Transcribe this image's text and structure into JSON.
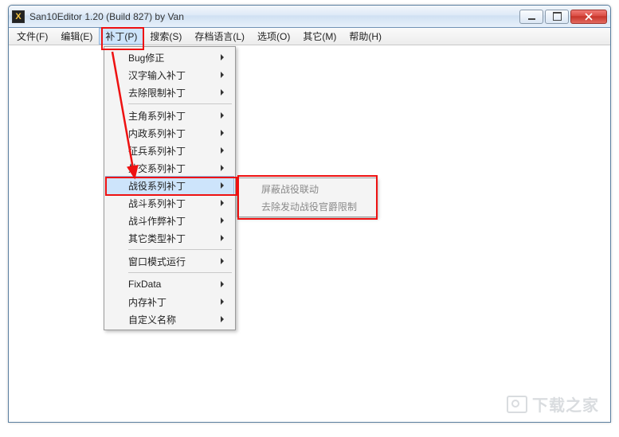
{
  "window": {
    "title": "San10Editor 1.20 (Build 827) by Van",
    "icon_letter": "X"
  },
  "menubar": {
    "items": [
      {
        "label": "文件(F)"
      },
      {
        "label": "编辑(E)"
      },
      {
        "label": "补丁(P)",
        "active": true
      },
      {
        "label": "搜索(S)"
      },
      {
        "label": "存档语言(L)"
      },
      {
        "label": "选项(O)"
      },
      {
        "label": "其它(M)"
      },
      {
        "label": "帮助(H)"
      }
    ]
  },
  "dropdown": {
    "groups": [
      [
        {
          "label": "Bug修正",
          "sub": true
        },
        {
          "label": "汉字输入补丁",
          "sub": true
        },
        {
          "label": "去除限制补丁",
          "sub": true
        }
      ],
      [
        {
          "label": "主角系列补丁",
          "sub": true
        },
        {
          "label": "内政系列补丁",
          "sub": true
        },
        {
          "label": "征兵系列补丁",
          "sub": true
        },
        {
          "label": "外交系列补丁",
          "sub": true
        },
        {
          "label": "战役系列补丁",
          "sub": true,
          "highlight": true
        },
        {
          "label": "战斗系列补丁",
          "sub": true
        },
        {
          "label": "战斗作弊补丁",
          "sub": true
        },
        {
          "label": "其它类型补丁",
          "sub": true
        }
      ],
      [
        {
          "label": "窗口模式运行",
          "sub": true
        }
      ],
      [
        {
          "label": "FixData",
          "sub": true
        },
        {
          "label": "内存补丁",
          "sub": true
        },
        {
          "label": "自定义名称",
          "sub": true
        }
      ]
    ]
  },
  "submenu": {
    "items": [
      {
        "label": "屏蔽战役联动"
      },
      {
        "label": "去除发动战役官爵限制"
      }
    ]
  },
  "watermark": "下载之家"
}
